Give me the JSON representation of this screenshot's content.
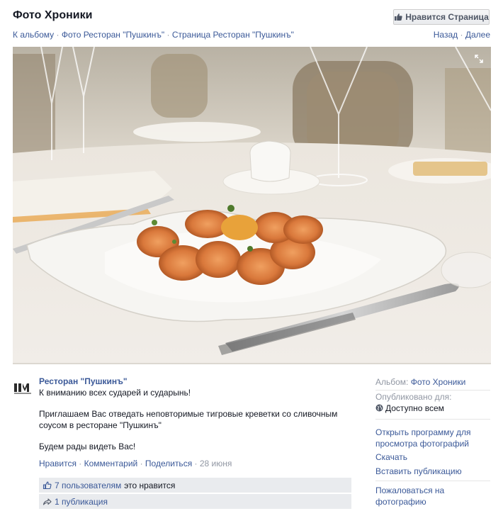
{
  "header": {
    "title": "Фото Хроники",
    "like_page_label": "Нравится Страница"
  },
  "breadcrumbs": {
    "to_album": "К альбому",
    "photos": "Фото Ресторан \"Пушкинъ\"",
    "page": "Страница Ресторан \"Пушкинъ\"",
    "separator": "·"
  },
  "nav": {
    "prev": "Назад",
    "next": "Далее",
    "separator": "·"
  },
  "post": {
    "author": "Ресторан \"Пушкинъ\"",
    "line1": "К вниманию всех сударей и сударынь!",
    "line2": "Приглашаем Вас отведать неповторимые тигровые креветки со сливочным соусом в ресторане \"Пушкинъ\"",
    "line3": "Будем рады видеть Вас!"
  },
  "actions": {
    "like": "Нравится",
    "comment": "Комментарий",
    "share": "Поделиться",
    "date": "28 июня",
    "separator": "·"
  },
  "ufi": {
    "likes_link": "7 пользователям",
    "likes_suffix": "это нравится",
    "shares": "1 публикация"
  },
  "sidebar": {
    "album_label": "Альбом:",
    "album_value": "Фото Хроники",
    "published_label": "Опубликовано для:",
    "audience": "Доступно всем",
    "open_viewer": "Открыть программу для просмотра фотографий",
    "download": "Скачать",
    "embed": "Вставить публикацию",
    "report": "Пожаловаться на фотографию"
  },
  "colors": {
    "link": "#3b5998",
    "muted": "#9197a3",
    "ufi_background": "#e9ebee"
  },
  "icons": {
    "like_page": "thumbs-up-icon",
    "likes": "thumbs-up-outline-icon",
    "shares": "share-arrow-icon",
    "audience": "globe-icon",
    "expand": "expand-icon"
  }
}
